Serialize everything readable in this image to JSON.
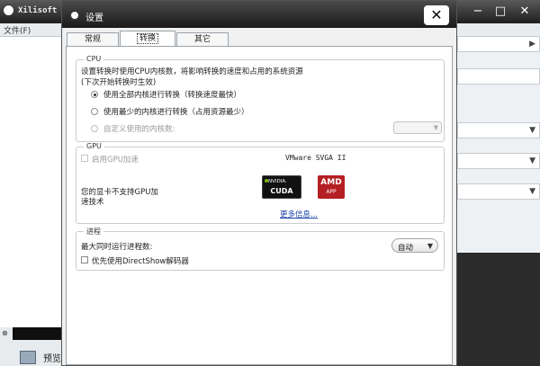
{
  "app": {
    "title": "Xilisoft ...",
    "menu_file": "文件(F)",
    "preview": "预览"
  },
  "dialog": {
    "title": "设置",
    "close_glyph": "✕",
    "tabs": [
      {
        "label": "常规"
      },
      {
        "label": "转换"
      },
      {
        "label": "其它"
      }
    ],
    "cpu": {
      "legend": "CPU",
      "desc_line1": "设置转换时使用CPU内核数，将影响转换的速度和占用的系统资源",
      "desc_line2": "(下次开始转换时生效)",
      "options": [
        {
          "label": "使用全部内核进行转换（转换速度最快）",
          "selected": true
        },
        {
          "label": "使用最少的内核进行转换（占用资源最少）",
          "selected": false
        },
        {
          "label": "自定义使用的内核数:",
          "selected": false
        }
      ]
    },
    "gpu": {
      "legend": "GPU",
      "enable_label": "启用GPU加速",
      "enable_checked": false,
      "device": "VMware SVGA II",
      "not_supported_line1": "您的显卡不支持GPU加",
      "not_supported_line2": "速技术",
      "nvidia_brand": "NVIDIA.",
      "nvidia_cuda": "CUDA",
      "amd_brand": "AMD",
      "amd_app": "APP",
      "more_info": "更多信息..."
    },
    "process": {
      "legend": "进程",
      "max_label": "最大同时运行进程数:",
      "max_value": "自动",
      "directshow_label": "优先使用DirectShow解码器",
      "directshow_checked": false
    }
  },
  "colors": {
    "accent_link": "#1a3fa8",
    "amd_red": "#b41f24",
    "nvidia_green": "#76b900"
  }
}
